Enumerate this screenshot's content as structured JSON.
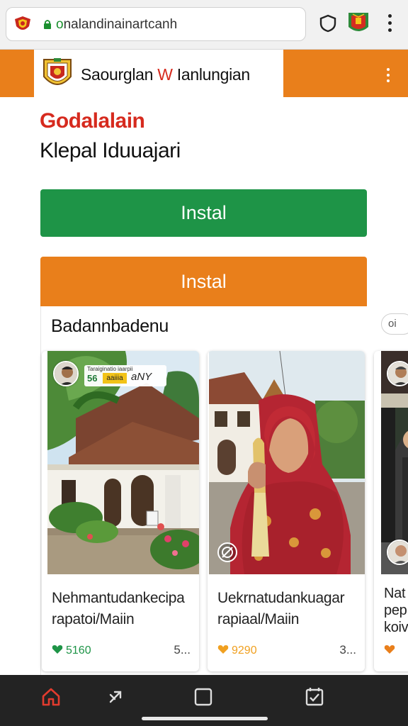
{
  "browser": {
    "url_highlight": "o",
    "url_rest": "nalandinainartcanh",
    "favicon_icon": "red-site-emblem-icon",
    "lock_icon": "lock-icon",
    "shield_icon": "shield-icon",
    "extension_icon": "emblem-badge-icon",
    "menu_icon": "vertical-dots-icon"
  },
  "site_header": {
    "brand_part1": "Saourglan ",
    "brand_part2": "W",
    "brand_part3": " Ianlungian",
    "logo_icon": "regional-emblem-icon",
    "menu_icon": "vertical-dots-icon",
    "accent_color": "#e97f1b"
  },
  "intro": {
    "title_red": "Godalalain",
    "title_black": "Klepal Iduuajari"
  },
  "buttons": {
    "primary_label": "Instal",
    "secondary_label": "Instal",
    "primary_color": "#1e9447",
    "secondary_color": "#e97f1b"
  },
  "section": {
    "title": "Badannbadenu",
    "more_label": "oi"
  },
  "cards": [
    {
      "title": "Nehmantudankecipa\nrapatoi/Maiin",
      "stat": "5160",
      "stat_color": "#1e9447",
      "more": "5...",
      "badge_top": "Taraiginatio iaarpii",
      "badge_num": "56",
      "badge_yellow": "aaiiia",
      "badge_sig": "aNY",
      "photo": "white colonial house with tiled roof and tropical garden"
    },
    {
      "title": "Uekrnatudankuagar\nrapiaal/Maiin",
      "stat": "9290",
      "stat_color": "#f0a020",
      "more": "3...",
      "photo": "woman in red hijab holding an ear of corn"
    },
    {
      "title": "Nat\npep\nkoiv",
      "stat": "",
      "stat_color": "#e97f1b",
      "more": "",
      "photo": "village street with people"
    }
  ],
  "bottom_nav": {
    "items": [
      "home-icon",
      "forward-icon",
      "tabs-icon",
      "bookmark-check-icon"
    ]
  }
}
